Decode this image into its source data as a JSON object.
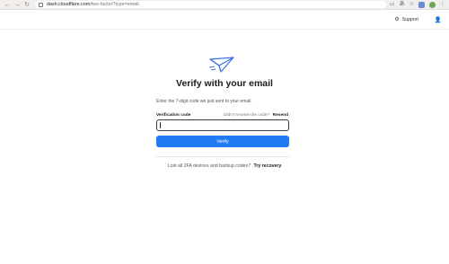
{
  "browser": {
    "url_host": "dash.cloudflare.com",
    "url_path": "/two-factor?type=email",
    "nav": {
      "back": "←",
      "forward": "→",
      "reload": "↻"
    }
  },
  "header": {
    "support_label": "Support",
    "support_icon": "gear-icon",
    "user_icon": "user-icon"
  },
  "main": {
    "icon": "paper-plane-icon",
    "title": "Verify with your email",
    "subtitle": "Enter the 7-digit code we just sent to your email.",
    "field_label": "Verification code",
    "resend_prompt": "Didn't receive the code?",
    "resend_link": "Resend",
    "code_value": "",
    "verify_label": "Verify",
    "recovery_prompt": "Lost all 2FA devices and backup codes?",
    "recovery_link": "Try recovery"
  },
  "colors": {
    "accent": "#1f7bf2",
    "plane": "#3f6fe8"
  }
}
